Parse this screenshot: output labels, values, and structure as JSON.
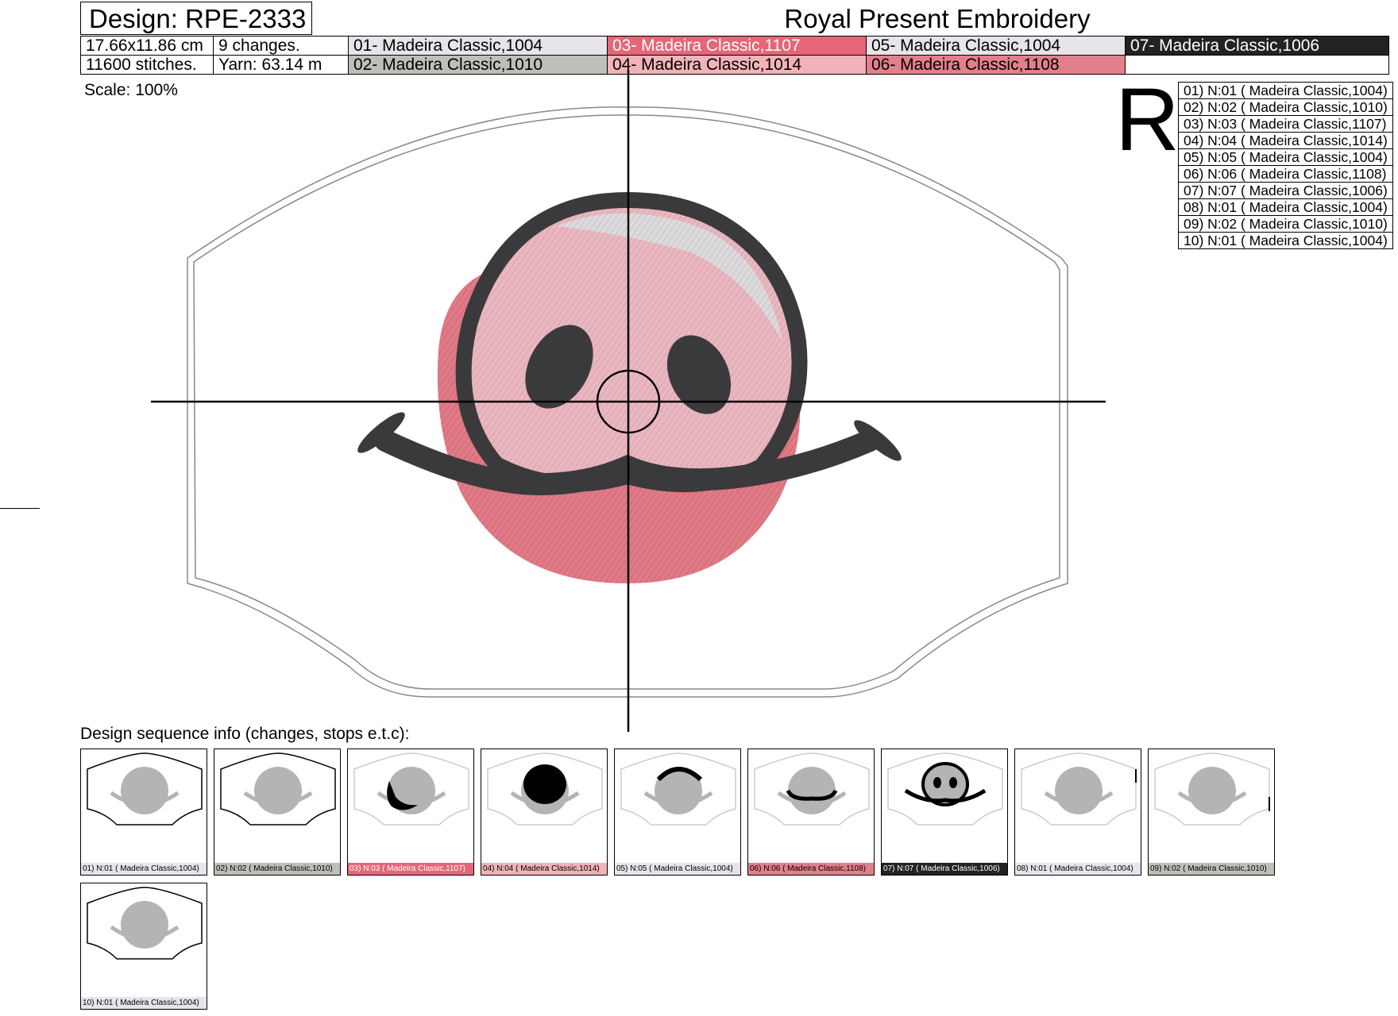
{
  "header": {
    "design_label": "Design: RPE-2333",
    "brand": "Royal Present Embroidery"
  },
  "info": {
    "size": "17.66x11.86 cm",
    "changes": "9 changes.",
    "stitches": "11600 stitches.",
    "yarn": "Yarn: 63.14 m"
  },
  "colors": [
    {
      "label": "01- Madeira Classic,1004",
      "bg": "#e7e4ea",
      "fg": "#000000"
    },
    {
      "label": "02- Madeira Classic,1010",
      "bg": "#bcc0b9",
      "fg": "#000000"
    },
    {
      "label": "03- Madeira Classic,1107",
      "bg": "#e56777",
      "fg": "#ffffff"
    },
    {
      "label": "04- Madeira Classic,1014",
      "bg": "#f1b3b9",
      "fg": "#000000"
    },
    {
      "label": "05- Madeira Classic,1004",
      "bg": "#e7e4ea",
      "fg": "#000000"
    },
    {
      "label": "06- Madeira Classic,1108",
      "bg": "#e37e8b",
      "fg": "#000000"
    },
    {
      "label": "07- Madeira Classic,1006",
      "bg": "#222222",
      "fg": "#ffffff"
    }
  ],
  "scale": "Scale: 100%",
  "rotation_mark": "R",
  "sequence": [
    "01) N:01 ( Madeira Classic,1004)",
    "02) N:02 ( Madeira Classic,1010)",
    "03) N:03 ( Madeira Classic,1107)",
    "04) N:04 ( Madeira Classic,1014)",
    "05) N:05 ( Madeira Classic,1004)",
    "06) N:06 ( Madeira Classic,1108)",
    "07) N:07 ( Madeira Classic,1006)",
    "08) N:01 ( Madeira Classic,1004)",
    "09) N:02 ( Madeira Classic,1010)",
    "10) N:01 ( Madeira Classic,1004)"
  ],
  "sequence_title": "Design sequence info (changes, stops e.t.c):",
  "thumbnails": [
    {
      "caption": "01) N:01 ( Madeira Classic,1004)",
      "bg": "#e7e4ea",
      "fg": "#000000"
    },
    {
      "caption": "02) N:02 ( Madeira Classic,1010)",
      "bg": "#bcc0b9",
      "fg": "#000000"
    },
    {
      "caption": "03) N:03 ( Madeira Classic,1107)",
      "bg": "#e56777",
      "fg": "#ffffff"
    },
    {
      "caption": "04) N:04 ( Madeira Classic,1014)",
      "bg": "#f1b3b9",
      "fg": "#000000"
    },
    {
      "caption": "05) N:05 ( Madeira Classic,1004)",
      "bg": "#e7e4ea",
      "fg": "#000000"
    },
    {
      "caption": "06) N:06 ( Madeira Classic,1108)",
      "bg": "#e37e8b",
      "fg": "#000000"
    },
    {
      "caption": "07) N:07 ( Madeira Classic,1006)",
      "bg": "#222222",
      "fg": "#ffffff"
    },
    {
      "caption": "08) N:01 ( Madeira Classic,1004)",
      "bg": "#e7e4ea",
      "fg": "#000000"
    },
    {
      "caption": "09) N:02 ( Madeira Classic,1010)",
      "bg": "#bcc0b9",
      "fg": "#000000"
    },
    {
      "caption": "10) N:01 ( Madeira Classic,1004)",
      "bg": "#e7e4ea",
      "fg": "#000000"
    }
  ]
}
